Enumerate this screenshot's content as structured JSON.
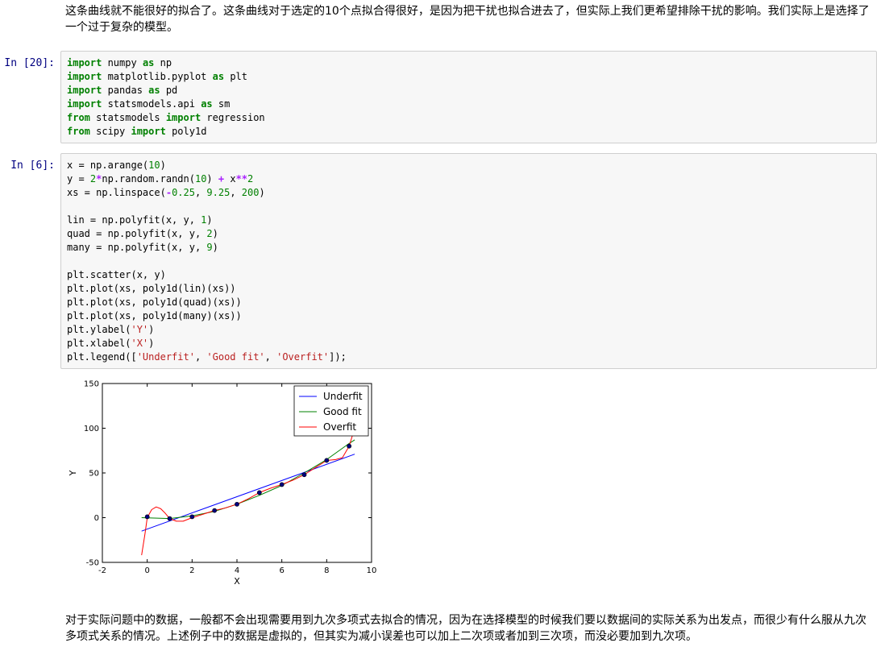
{
  "markdown_top": {
    "line1": "这条曲线就不能很好的拟合了。这条曲线对于选定的10个点拟合得很好，是因为把干扰也拟合进去了，但实际上我们更希望排除干扰的影响。我们实际上是选择了",
    "line2": "一个过于复杂的模型。"
  },
  "cell1": {
    "prompt": "In [20]:",
    "lines": [
      [
        [
          "kw",
          "import"
        ],
        [
          "t",
          " numpy "
        ],
        [
          "kw",
          "as"
        ],
        [
          "t",
          " np"
        ]
      ],
      [
        [
          "kw",
          "import"
        ],
        [
          "t",
          " matplotlib.pyplot "
        ],
        [
          "kw",
          "as"
        ],
        [
          "t",
          " plt"
        ]
      ],
      [
        [
          "kw",
          "import"
        ],
        [
          "t",
          " pandas "
        ],
        [
          "kw",
          "as"
        ],
        [
          "t",
          " pd"
        ]
      ],
      [
        [
          "kw",
          "import"
        ],
        [
          "t",
          " statsmodels.api "
        ],
        [
          "kw",
          "as"
        ],
        [
          "t",
          " sm"
        ]
      ],
      [
        [
          "kw",
          "from"
        ],
        [
          "t",
          " statsmodels "
        ],
        [
          "kw",
          "import"
        ],
        [
          "t",
          " regression"
        ]
      ],
      [
        [
          "kw",
          "from"
        ],
        [
          "t",
          " scipy "
        ],
        [
          "kw",
          "import"
        ],
        [
          "t",
          " poly1d"
        ]
      ]
    ]
  },
  "cell2": {
    "prompt": "In [6]:",
    "lines": [
      [
        [
          "t",
          "x = np.arange("
        ],
        [
          "num",
          "10"
        ],
        [
          "t",
          ")"
        ]
      ],
      [
        [
          "t",
          "y = "
        ],
        [
          "num",
          "2"
        ],
        [
          "op",
          "*"
        ],
        [
          "t",
          "np.random.randn("
        ],
        [
          "num",
          "10"
        ],
        [
          "t",
          ") "
        ],
        [
          "op",
          "+"
        ],
        [
          "t",
          " x"
        ],
        [
          "op",
          "**"
        ],
        [
          "num",
          "2"
        ]
      ],
      [
        [
          "t",
          "xs = np.linspace("
        ],
        [
          "op",
          "-"
        ],
        [
          "num",
          "0.25"
        ],
        [
          "t",
          ", "
        ],
        [
          "num",
          "9.25"
        ],
        [
          "t",
          ", "
        ],
        [
          "num",
          "200"
        ],
        [
          "t",
          ")"
        ]
      ],
      [],
      [
        [
          "t",
          "lin = np.polyfit(x, y, "
        ],
        [
          "num",
          "1"
        ],
        [
          "t",
          ")"
        ]
      ],
      [
        [
          "t",
          "quad = np.polyfit(x, y, "
        ],
        [
          "num",
          "2"
        ],
        [
          "t",
          ")"
        ]
      ],
      [
        [
          "t",
          "many = np.polyfit(x, y, "
        ],
        [
          "num",
          "9"
        ],
        [
          "t",
          ")"
        ]
      ],
      [],
      [
        [
          "t",
          "plt.scatter(x, y)"
        ]
      ],
      [
        [
          "t",
          "plt.plot(xs, poly1d(lin)(xs))"
        ]
      ],
      [
        [
          "t",
          "plt.plot(xs, poly1d(quad)(xs))"
        ]
      ],
      [
        [
          "t",
          "plt.plot(xs, poly1d(many)(xs))"
        ]
      ],
      [
        [
          "t",
          "plt.ylabel("
        ],
        [
          "str",
          "'Y'"
        ],
        [
          "t",
          ")"
        ]
      ],
      [
        [
          "t",
          "plt.xlabel("
        ],
        [
          "str",
          "'X'"
        ],
        [
          "t",
          ")"
        ]
      ],
      [
        [
          "t",
          "plt.legend(["
        ],
        [
          "str",
          "'Underfit'"
        ],
        [
          "t",
          ", "
        ],
        [
          "str",
          "'Good fit'"
        ],
        [
          "t",
          ", "
        ],
        [
          "str",
          "'Overfit'"
        ],
        [
          "t",
          "]);"
        ]
      ]
    ]
  },
  "chart_data": {
    "type": "scatter",
    "xlabel": "X",
    "ylabel": "Y",
    "xlim": [
      -2,
      10
    ],
    "ylim": [
      -50,
      150
    ],
    "xticks": [
      -2,
      0,
      2,
      4,
      6,
      8,
      10
    ],
    "yticks": [
      -50,
      0,
      50,
      100,
      150
    ],
    "grid": false,
    "legend_position": "top-right",
    "points": {
      "x": [
        0,
        1,
        2,
        3,
        4,
        5,
        6,
        7,
        8,
        9
      ],
      "y": [
        1,
        -1,
        1,
        8,
        15,
        28,
        37,
        48,
        64,
        80
      ]
    },
    "series": [
      {
        "name": "Underfit",
        "color": "#0000ff",
        "kind": "linear",
        "x": [
          -0.25,
          9.25
        ],
        "y": [
          -15,
          71
        ]
      },
      {
        "name": "Good fit",
        "color": "#008000",
        "kind": "quadratic",
        "x": [
          -0.25,
          1,
          2,
          3,
          4,
          5,
          6,
          7,
          8,
          9,
          9.25
        ],
        "y": [
          0,
          -1,
          2,
          7,
          15,
          25,
          36,
          50,
          65,
          83,
          87
        ]
      },
      {
        "name": "Overfit",
        "color": "#ff0000",
        "kind": "degree9",
        "x": [
          -0.25,
          -0.1,
          0,
          0.2,
          0.4,
          0.6,
          0.8,
          1.0,
          1.3,
          1.6,
          2.0,
          2.5,
          3.0,
          3.5,
          4.0,
          4.5,
          5.0,
          5.5,
          6.0,
          6.5,
          7.0,
          7.5,
          8.0,
          8.4,
          8.7,
          9.0,
          9.15,
          9.25
        ],
        "y": [
          -42,
          -18,
          0,
          9,
          12,
          10,
          5,
          -1,
          -4,
          -4,
          0,
          4,
          8,
          11,
          15,
          21,
          28,
          33,
          37,
          42,
          48,
          56,
          64,
          65,
          67,
          80,
          92,
          100
        ]
      }
    ]
  },
  "markdown_bottom": {
    "line1": "对于实际问题中的数据，一般都不会出现需要用到九次多项式去拟合的情况，因为在选择模型的时候我们要以数据间的实际关系为出发点，而很少有什么服从九次",
    "line2": "多项式关系的情况。上述例子中的数据是虚拟的，但其实为减小误差也可以加上二次项或者加到三次项，而没必要加到九次项。"
  }
}
